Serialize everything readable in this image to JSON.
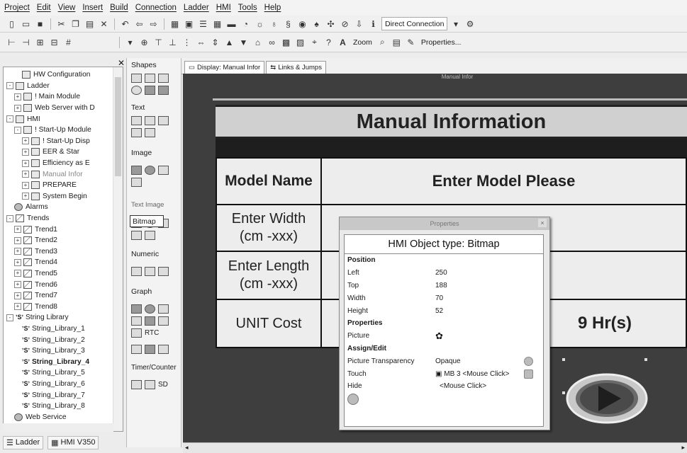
{
  "menu": [
    "Project",
    "Edit",
    "View",
    "Insert",
    "Build",
    "Connection",
    "Ladder",
    "HMI",
    "Tools",
    "Help"
  ],
  "toolbar": {
    "connection": "Direct Connection",
    "zoom_label": "Zoom",
    "properties_label": "Properties..."
  },
  "tree": [
    {
      "label": "HW Configuration",
      "indent": 1,
      "expander": "",
      "icon": "hardware-icon"
    },
    {
      "label": "Ladder",
      "indent": 0,
      "expander": "-",
      "icon": "ladder-icon"
    },
    {
      "label": "! Main Module",
      "indent": 1,
      "expander": "+",
      "icon": "module-icon"
    },
    {
      "label": "Web Server with D",
      "indent": 1,
      "expander": "+",
      "icon": "module-icon"
    },
    {
      "label": "HMI",
      "indent": 0,
      "expander": "-",
      "icon": "hmi-icon"
    },
    {
      "label": "! Start-Up Module",
      "indent": 1,
      "expander": "-",
      "icon": "module-icon"
    },
    {
      "label": "! Start-Up Disp",
      "indent": 2,
      "expander": "+",
      "icon": "display-icon"
    },
    {
      "label": "EER & Star",
      "indent": 2,
      "expander": "+",
      "icon": "display-icon"
    },
    {
      "label": "Efficiency as E",
      "indent": 2,
      "expander": "+",
      "icon": "display-icon"
    },
    {
      "label": "Manual Infor",
      "indent": 2,
      "expander": "+",
      "icon": "display-icon",
      "muted": true
    },
    {
      "label": "PREPARE",
      "indent": 2,
      "expander": "+",
      "icon": "display-icon"
    },
    {
      "label": "System Begin",
      "indent": 2,
      "expander": "+",
      "icon": "display-icon"
    },
    {
      "label": "Alarms",
      "indent": 0,
      "expander": "",
      "icon": "alarm-icon"
    },
    {
      "label": "Trends",
      "indent": 0,
      "expander": "-",
      "icon": "trend-icon"
    },
    {
      "label": "Trend1",
      "indent": 1,
      "expander": "+",
      "icon": "trend-icon"
    },
    {
      "label": "Trend2",
      "indent": 1,
      "expander": "+",
      "icon": "trend-icon"
    },
    {
      "label": "Trend3",
      "indent": 1,
      "expander": "+",
      "icon": "trend-icon"
    },
    {
      "label": "Trend4",
      "indent": 1,
      "expander": "+",
      "icon": "trend-icon"
    },
    {
      "label": "Trend5",
      "indent": 1,
      "expander": "+",
      "icon": "trend-icon"
    },
    {
      "label": "Trend6",
      "indent": 1,
      "expander": "+",
      "icon": "trend-icon"
    },
    {
      "label": "Trend7",
      "indent": 1,
      "expander": "+",
      "icon": "trend-icon"
    },
    {
      "label": "Trend8",
      "indent": 1,
      "expander": "+",
      "icon": "trend-icon"
    },
    {
      "label": "String Library",
      "indent": 0,
      "expander": "-",
      "icon": "string-library-icon"
    },
    {
      "label": "String_Library_1",
      "indent": 1,
      "expander": "",
      "icon": "string-library-icon"
    },
    {
      "label": "String_Library_2",
      "indent": 1,
      "expander": "",
      "icon": "string-library-icon"
    },
    {
      "label": "String_Library_3",
      "indent": 1,
      "expander": "",
      "icon": "string-library-icon"
    },
    {
      "label": "String_Library_4",
      "indent": 1,
      "expander": "",
      "icon": "string-library-icon",
      "bold": true
    },
    {
      "label": "String_Library_5",
      "indent": 1,
      "expander": "",
      "icon": "string-library-icon"
    },
    {
      "label": "String_Library_6",
      "indent": 1,
      "expander": "",
      "icon": "string-library-icon"
    },
    {
      "label": "String_Library_7",
      "indent": 1,
      "expander": "",
      "icon": "string-library-icon"
    },
    {
      "label": "String_Library_8",
      "indent": 1,
      "expander": "",
      "icon": "string-library-icon"
    },
    {
      "label": "Web Service",
      "indent": 0,
      "expander": "",
      "icon": "web-service-icon"
    }
  ],
  "bottom_tabs": {
    "ladder": "Ladder",
    "hmi": "HMI V350"
  },
  "shapes_panel": {
    "shapes": "Shapes",
    "text": "Text",
    "image": "Image",
    "bitmap_tooltip": "Bitmap",
    "text_image": "Text Image",
    "numeric": "Numeric",
    "graph": "Graph",
    "rtc": "RTC",
    "timer_counter": "Timer/Counter",
    "sd": "SD"
  },
  "tabs": {
    "display": "Display: Manual Infor",
    "links": "Links & Jumps"
  },
  "screen": {
    "canvas_title": "Manual Infor",
    "title": "Manual Information",
    "model_name_label": "Model Name",
    "model_prompt": "Enter Model Please",
    "width_label_1": "Enter Width",
    "width_label_2": "(cm -xxx)",
    "length_label_1": "Enter Length",
    "length_label_2": "(cm -xxx)",
    "unit_cost_label": "UNIT Cost",
    "hours_value": "9 Hr(s)"
  },
  "properties": {
    "window_title": "Properties",
    "header": "HMI Object type: Bitmap",
    "position_heading": "Position",
    "left_label": "Left",
    "left_value": "250",
    "top_label": "Top",
    "top_value": "188",
    "width_label": "Width",
    "width_value": "70",
    "height_label": "Height",
    "height_value": "52",
    "properties_heading": "Properties",
    "picture_label": "Picture",
    "assign_heading": "Assign/Edit",
    "transparency_label": "Picture Transparency",
    "transparency_value": "Opaque",
    "touch_label": "Touch",
    "touch_value": "MB 3 <Mouse Click>",
    "hide_label": "Hide",
    "hide_value": "<Mouse Click>"
  }
}
